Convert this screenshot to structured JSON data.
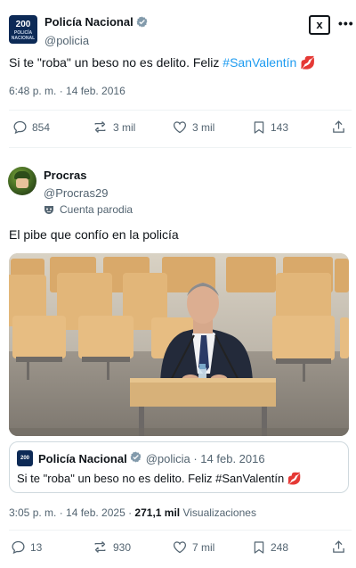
{
  "tweet1": {
    "author": {
      "name": "Policía Nacional",
      "handle": "@policia"
    },
    "avatar_text": "200",
    "avatar_subtext": "POLICÍA NACIONAL",
    "grok_label": "x",
    "more_label": "•••",
    "text_before": "Si te \"roba\" un beso no es delito. Feliz ",
    "hashtag": "#SanValentín",
    "emoji": "💋",
    "timestamp": "6:48 p. m. · 14 feb. 2016",
    "stats": {
      "replies": "854",
      "reposts": "3 mil",
      "likes": "3 mil",
      "bookmarks": "143"
    }
  },
  "tweet2": {
    "author": {
      "name": "Procras",
      "handle": "@Procras29"
    },
    "parody_label": "Cuenta parodia",
    "text": "El pibe que confío en la policía",
    "quote": {
      "avatar_text": "200",
      "name": "Policía Nacional",
      "handle_date": "@policia · 14 feb. 2016",
      "text": "Si te \"roba\" un beso no es delito. Feliz #SanValentín 💋"
    },
    "timestamp": "3:05 p. m. · 14 feb. 2025 · ",
    "views_count": "271,1 mil",
    "views_label": " Visualizaciones",
    "stats": {
      "replies": "13",
      "reposts": "930",
      "likes": "7 mil",
      "bookmarks": "248"
    }
  },
  "colors": {
    "accent": "#1d9bf0",
    "muted": "#536471",
    "text": "#0f1419",
    "divider": "#eff3f4"
  },
  "icons": [
    "verified-badge-icon",
    "grok-icon",
    "more-icon",
    "reply-icon",
    "repost-icon",
    "like-icon",
    "bookmark-icon",
    "share-icon",
    "parody-mask-icon"
  ]
}
